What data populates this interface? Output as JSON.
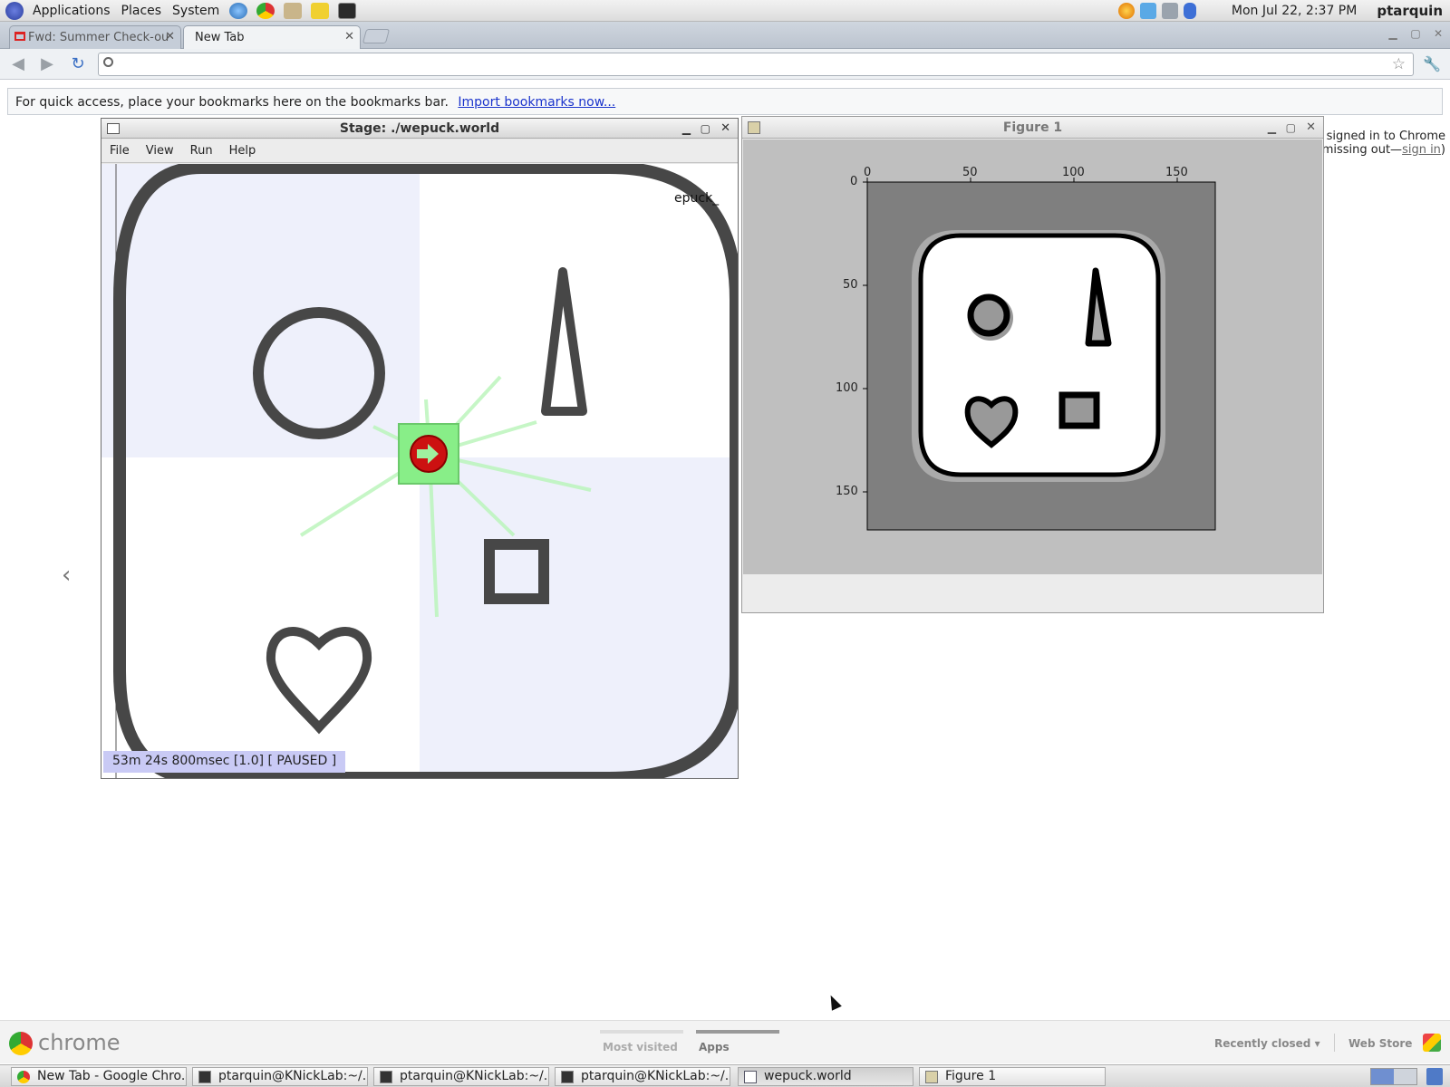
{
  "top_panel": {
    "menus": [
      "Applications",
      "Places",
      "System"
    ],
    "datetime": "Mon Jul 22,  2:37 PM",
    "user": "ptarquin"
  },
  "browser": {
    "tabs": [
      {
        "title": "Fwd: Summer Check-ou"
      },
      {
        "title": "New Tab"
      }
    ],
    "bookmarks_notice": "For quick access, place your bookmarks here on the bookmarks bar.",
    "import_link": "Import bookmarks now...",
    "signin_line1": "signed in to Chrome",
    "signin_line2_prefix": "missing out—",
    "signin_link": "sign in",
    "signin_suffix": ")",
    "chrome_wordmark": "chrome",
    "ntp_tabs": {
      "most_visited": "Most visited",
      "apps": "Apps"
    },
    "recently_closed": "Recently closed",
    "web_store": "Web Store"
  },
  "stage_window": {
    "title": "Stage: ./wepuck.world",
    "menus": [
      "File",
      "View",
      "Run",
      "Help"
    ],
    "robot_label": "epuck_",
    "status": "53m 24s 800msec [1.0] [ PAUSED ]"
  },
  "figure_window": {
    "title": "Figure 1",
    "x_ticks": [
      "0",
      "50",
      "100",
      "150"
    ],
    "y_ticks": [
      "0",
      "50",
      "100",
      "150"
    ]
  },
  "taskbar": {
    "items": [
      {
        "label": "New Tab - Google Chro..."
      },
      {
        "label": "ptarquin@KNickLab:~/..."
      },
      {
        "label": "ptarquin@KNickLab:~/..."
      },
      {
        "label": "ptarquin@KNickLab:~/..."
      },
      {
        "label": "wepuck.world"
      },
      {
        "label": "Figure 1"
      }
    ]
  },
  "colors": {
    "accent_link": "#1a33cc",
    "robot_body": "#cc1111",
    "robot_base": "#88ee88",
    "status_bg": "#c9caf5",
    "wall": "#444444"
  }
}
